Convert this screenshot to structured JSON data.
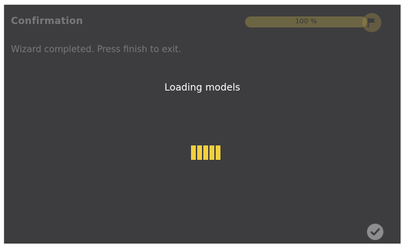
{
  "wizard": {
    "title": "Confirmation",
    "message": "Wizard completed. Press finish to exit."
  },
  "progress": {
    "label": "100 %",
    "value": 1.0,
    "track_color": "#8a8250",
    "fill_color": "#b8a84a"
  },
  "overlay": {
    "loading_label": "Loading models",
    "loader_color": "#f2cf3e",
    "loader_segments": 5
  },
  "icons": {
    "flag": "flag-icon",
    "finish": "checkmark-icon"
  }
}
